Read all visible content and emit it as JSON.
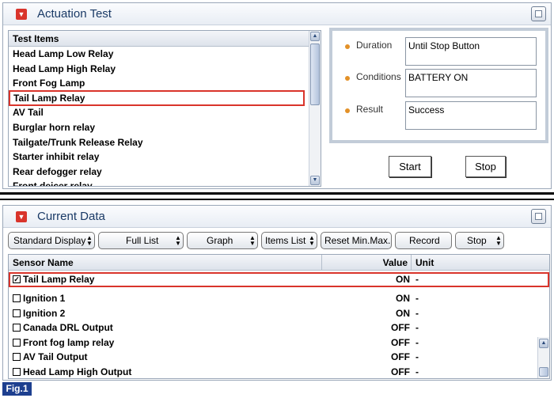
{
  "actuation": {
    "title": "Actuation Test",
    "list_header": "Test Items",
    "items": [
      "Head Lamp Low Relay",
      "Head Lamp High Relay",
      "Front Fog Lamp",
      "Tail Lamp Relay",
      "AV Tail",
      "Burglar horn relay",
      "Tailgate/Trunk Release Relay",
      "Starter inhibit relay",
      "Rear defogger relay",
      "Front deicer relay"
    ],
    "selected_item": "Tail Lamp Relay",
    "duration_label": "Duration",
    "duration_value": "Until Stop Button",
    "conditions_label": "Conditions",
    "conditions_value": "BATTERY ON",
    "result_label": "Result",
    "result_value": "Success",
    "start_label": "Start",
    "stop_label": "Stop"
  },
  "current": {
    "title": "Current Data",
    "toolbar": {
      "display": "Standard Display",
      "list": "Full List",
      "graph": "Graph",
      "items_list": "Items List",
      "reset": "Reset Min.Max.",
      "record": "Record",
      "stop": "Stop"
    },
    "col_sensor": "Sensor Name",
    "col_value": "Value",
    "col_unit": "Unit",
    "rows": [
      {
        "name": "Tail Lamp Relay",
        "value": "ON",
        "unit": "-",
        "checked": true
      },
      {
        "name": "Ignition 1",
        "value": "ON",
        "unit": "-",
        "checked": false
      },
      {
        "name": "Ignition 2",
        "value": "ON",
        "unit": "-",
        "checked": false
      },
      {
        "name": "Canada DRL Output",
        "value": "OFF",
        "unit": "-",
        "checked": false
      },
      {
        "name": "Front fog lamp relay",
        "value": "OFF",
        "unit": "-",
        "checked": false
      },
      {
        "name": "AV Tail Output",
        "value": "OFF",
        "unit": "-",
        "checked": false
      },
      {
        "name": "Head Lamp High Output",
        "value": "OFF",
        "unit": "-",
        "checked": false
      }
    ]
  },
  "figure_label": "Fig.1",
  "icons": {
    "collapse": "collapse-arrow-icon",
    "maximize": "maximize-icon",
    "bullet": "bullet-icon",
    "caret": "updown-caret-icon",
    "checkbox": "checkbox-icon"
  },
  "colors": {
    "highlight": "#d9342b",
    "title_text": "#1a3a66",
    "bullet": "#e39128",
    "info_frame": "#c2ccd8",
    "figure_badge": "#1d3f8f"
  }
}
